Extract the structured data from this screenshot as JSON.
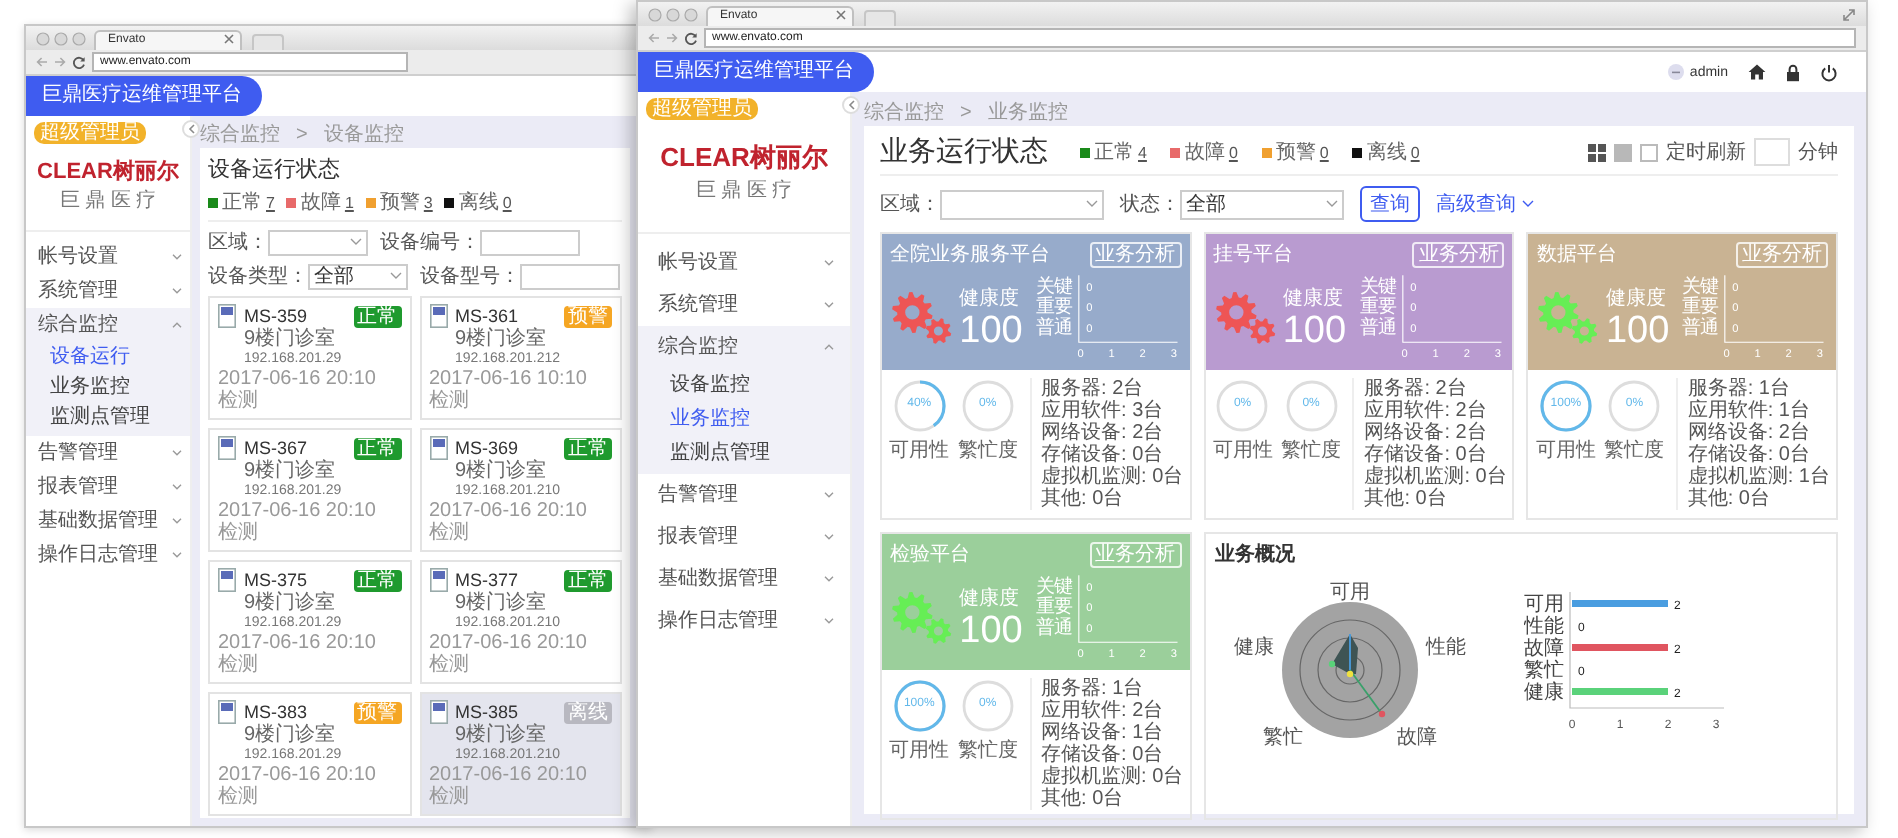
{
  "windows": [
    {
      "kind": "device",
      "tab": "Envato",
      "url": "www.envato.com",
      "brand": "巨鼎医疗运维管理平台",
      "role_badge": "超级管理员",
      "logo": "CLEAR树丽尔",
      "logo_sub": "巨 鼎 医 疗",
      "menu": [
        {
          "label": "帐号设置",
          "expanded": false
        },
        {
          "label": "系统管理",
          "expanded": false
        },
        {
          "label": "综合监控",
          "expanded": true,
          "children": [
            {
              "label": "设备运行",
              "selected": true
            },
            {
              "label": "业务监控",
              "selected": false
            },
            {
              "label": "监测点管理",
              "selected": false
            }
          ]
        },
        {
          "label": "告警管理",
          "expanded": false
        },
        {
          "label": "报表管理",
          "expanded": false
        },
        {
          "label": "基础数据管理",
          "expanded": false
        },
        {
          "label": "操作日志管理",
          "expanded": false
        }
      ],
      "breadcrumb": [
        "综合监控",
        "设备监控"
      ],
      "breadcrumb_separator": ">",
      "title": "设备运行状态",
      "legend": [
        {
          "label": "正常",
          "count": "7",
          "color": "#1a8a1a"
        },
        {
          "label": "故障",
          "count": "1",
          "color": "#e86a6a"
        },
        {
          "label": "预警",
          "count": "3",
          "color": "#f0a030"
        },
        {
          "label": "离线",
          "count": "0",
          "color": "#111111"
        }
      ],
      "filters": [
        {
          "kind": "select",
          "label": "区域："
        },
        {
          "kind": "input",
          "label": "设备编号："
        },
        {
          "kind": "select",
          "label": "设备类型：",
          "value": "全部"
        },
        {
          "kind": "input",
          "label": "设备型号："
        }
      ],
      "devices": [
        {
          "name": "MS-359",
          "status": "正常",
          "color": "#1f9a2e",
          "location": "9楼门诊室",
          "ip": "192.168.201.29",
          "time": "2017-06-16 20:10 检测",
          "selected": false
        },
        {
          "name": "MS-361",
          "status": "预警",
          "color": "#f5a623",
          "location": "9楼门诊室",
          "ip": "192.168.201.212",
          "time": "2017-06-16 10:10 检测",
          "selected": false
        },
        {
          "name": "MS-367",
          "status": "正常",
          "color": "#1f9a2e",
          "location": "9楼门诊室",
          "ip": "192.168.201.29",
          "time": "2017-06-16 20:10 检测",
          "selected": false
        },
        {
          "name": "MS-369",
          "status": "正常",
          "color": "#1f9a2e",
          "location": "9楼门诊室",
          "ip": "192.168.201.210",
          "time": "2017-06-16 20:10 检测",
          "selected": false
        },
        {
          "name": "MS-375",
          "status": "正常",
          "color": "#1f9a2e",
          "location": "9楼门诊室",
          "ip": "192.168.201.29",
          "time": "2017-06-16 20:10 检测",
          "selected": false
        },
        {
          "name": "MS-377",
          "status": "正常",
          "color": "#1f9a2e",
          "location": "9楼门诊室",
          "ip": "192.168.201.210",
          "time": "2017-06-16 20:10 检测",
          "selected": false
        },
        {
          "name": "MS-383",
          "status": "预警",
          "color": "#f5a623",
          "location": "9楼门诊室",
          "ip": "192.168.201.29",
          "time": "2017-06-16 20:10 检测",
          "selected": false
        },
        {
          "name": "MS-385",
          "status": "离线",
          "color": "#b8b8c0",
          "location": "9楼门诊室",
          "ip": "192.168.201.210",
          "time": "2017-06-16 20:10 检测",
          "selected": true
        }
      ]
    },
    {
      "kind": "business",
      "tab": "Envato",
      "url": "www.envato.com",
      "brand": "巨鼎医疗运维管理平台",
      "user": "admin",
      "role_badge": "超级管理员",
      "logo": "CLEAR树丽尔",
      "logo_sub": "巨 鼎 医 疗",
      "menu": [
        {
          "label": "帐号设置",
          "expanded": false
        },
        {
          "label": "系统管理",
          "expanded": false
        },
        {
          "label": "综合监控",
          "expanded": true,
          "children": [
            {
              "label": "设备监控",
              "selected": false
            },
            {
              "label": "业务监控",
              "selected": true
            },
            {
              "label": "监测点管理",
              "selected": false
            }
          ]
        },
        {
          "label": "告警管理",
          "expanded": false
        },
        {
          "label": "报表管理",
          "expanded": false
        },
        {
          "label": "基础数据管理",
          "expanded": false
        },
        {
          "label": "操作日志管理",
          "expanded": false
        }
      ],
      "breadcrumb": [
        "综合监控",
        "业务监控"
      ],
      "breadcrumb_separator": ">",
      "title": "业务运行状态",
      "legend": [
        {
          "label": "正常",
          "count": "4",
          "color": "#1a8a1a"
        },
        {
          "label": "故障",
          "count": "0",
          "color": "#e86a6a"
        },
        {
          "label": "预警",
          "count": "0",
          "color": "#f0a030"
        },
        {
          "label": "离线",
          "count": "0",
          "color": "#111111"
        }
      ],
      "tools": {
        "refresh_label": "定时刷新",
        "refresh_checked": false,
        "unit": "分钟"
      },
      "filters": [
        {
          "kind": "select",
          "label": "区域："
        },
        {
          "kind": "select",
          "label": "状态：",
          "value": "全部"
        }
      ],
      "actions": [
        {
          "kind": "button",
          "label": "查询"
        },
        {
          "kind": "link",
          "label": "高级查询"
        }
      ],
      "platforms": [
        {
          "name": "全院业务服务平台",
          "color": "#97abcb",
          "alert": true,
          "action": "业务分析",
          "health_label": "健康度",
          "health": "100",
          "chart_data": {
            "type": "bar",
            "orientation": "horizontal",
            "categories": [
              "关键",
              "重要",
              "普通"
            ],
            "values": [
              0,
              0,
              0
            ],
            "xlim": [
              0,
              3
            ],
            "xticks": [
              0,
              1,
              2,
              3
            ],
            "data_labels": true
          },
          "gauges": [
            {
              "label": "可用性",
              "value": "40%",
              "level": 0.4
            },
            {
              "label": "繁忙度",
              "value": "0%",
              "level": 0
            }
          ],
          "stats": [
            "服务器: 2台",
            "应用软件: 3台",
            "网络设备: 2台",
            "存储设备: 0台",
            "虚拟机监测: 0台",
            "其他: 0台"
          ]
        },
        {
          "name": "挂号平台",
          "color": "#b99bd0",
          "alert": true,
          "action": "业务分析",
          "health_label": "健康度",
          "health": "100",
          "chart_data": {
            "type": "bar",
            "orientation": "horizontal",
            "categories": [
              "关键",
              "重要",
              "普通"
            ],
            "values": [
              0,
              0,
              0
            ],
            "xlim": [
              0,
              3
            ],
            "xticks": [
              0,
              1,
              2,
              3
            ],
            "data_labels": true
          },
          "gauges": [
            {
              "label": "可用性",
              "value": "0%",
              "level": 0
            },
            {
              "label": "繁忙度",
              "value": "0%",
              "level": 0
            }
          ],
          "stats": [
            "服务器: 2台",
            "应用软件: 2台",
            "网络设备: 2台",
            "存储设备: 0台",
            "虚拟机监测: 0台",
            "其他: 0台"
          ]
        },
        {
          "name": "数据平台",
          "color": "#c9b393",
          "alert": false,
          "action": "业务分析",
          "health_label": "健康度",
          "health": "100",
          "chart_data": {
            "type": "bar",
            "orientation": "horizontal",
            "categories": [
              "关键",
              "重要",
              "普通"
            ],
            "values": [
              0,
              0,
              0
            ],
            "xlim": [
              0,
              3
            ],
            "xticks": [
              0,
              1,
              2,
              3
            ],
            "data_labels": true
          },
          "gauges": [
            {
              "label": "可用性",
              "value": "100%",
              "level": 1
            },
            {
              "label": "繁忙度",
              "value": "0%",
              "level": 0
            }
          ],
          "stats": [
            "服务器: 1台",
            "应用软件: 1台",
            "网络设备: 2台",
            "存储设备: 0台",
            "虚拟机监测: 1台",
            "其他: 0台"
          ]
        },
        {
          "name": "检验平台",
          "color": "#9bcf9b",
          "alert": false,
          "action": "业务分析",
          "health_label": "健康度",
          "health": "100",
          "chart_data": {
            "type": "bar",
            "orientation": "horizontal",
            "categories": [
              "关键",
              "重要",
              "普通"
            ],
            "values": [
              0,
              0,
              0
            ],
            "xlim": [
              0,
              3
            ],
            "xticks": [
              0,
              1,
              2,
              3
            ],
            "data_labels": true
          },
          "gauges": [
            {
              "label": "可用性",
              "value": "100%",
              "level": 1
            },
            {
              "label": "繁忙度",
              "value": "0%",
              "level": 0
            }
          ],
          "stats": [
            "服务器: 1台",
            "应用软件: 2台",
            "网络设备: 1台",
            "存储设备: 0台",
            "虚拟机监测: 0台",
            "其他: 0台"
          ]
        }
      ],
      "overview": {
        "title": "业务概况",
        "radar_labels": [
          "可用",
          "性能",
          "故障",
          "繁忙",
          "健康"
        ],
        "chart_data": {
          "type": "bar",
          "orientation": "horizontal",
          "categories": [
            "可用",
            "性能",
            "故障",
            "繁忙",
            "健康"
          ],
          "values": [
            2,
            0,
            2,
            0,
            2
          ],
          "colors": [
            "#4a9de0",
            "#4a9de0",
            "#e05560",
            "#e05560",
            "#5ad27a"
          ],
          "xlim": [
            0,
            3
          ],
          "xticks": [
            0,
            1,
            2,
            3
          ],
          "data_labels": true
        }
      }
    }
  ]
}
